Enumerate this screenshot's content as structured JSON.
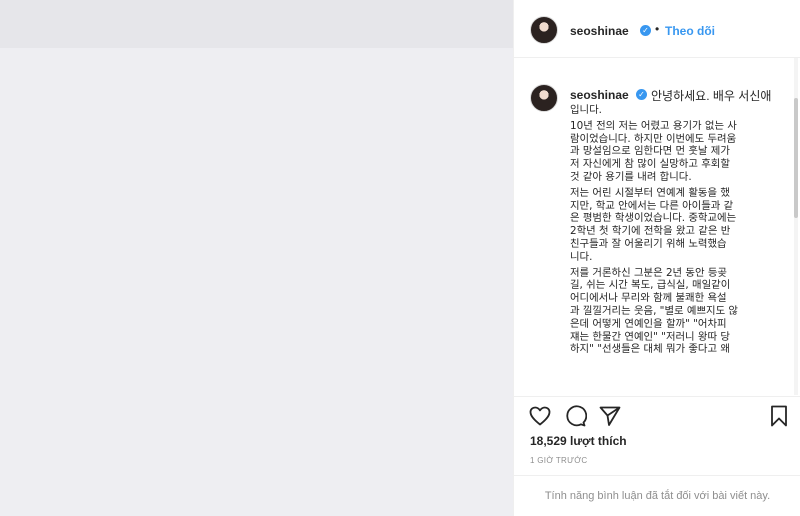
{
  "header": {
    "username": "seoshinae",
    "separator": "•",
    "follow_label": "Theo dõi",
    "verified_icon": "verified-badge-icon",
    "avatar_icon": "profile-avatar"
  },
  "post": {
    "username": "seoshinae",
    "caption_lead": "안녕하세요. 배우 서신애",
    "caption_lines": [
      "입니다.",
      "",
      "10년 전의 저는 어렸고 용기가 없는 사",
      "람이었습니다. 하지만 이번에도 두려움",
      "과 망설임으로 임한다면 먼 훗날 제가",
      "저 자신에게 참 많이 실망하고 후회할",
      "것 같아 용기를 내려 합니다.",
      "",
      "저는 어린 시절부터 연예계 활동을 했",
      "지만, 학교 안에서는 다른 아이들과 같",
      "은 평범한 학생이었습니다. 중학교에는",
      "2학년 첫 학기에 전학을 왔고 같은 반",
      "친구들과 잘 어울리기 위해 노력했습",
      "니다.",
      "",
      "저를 거론하신 그분은 2년 동안 등곶",
      "길, 쉬는 시간 복도, 급식실, 매일같이",
      "어디에서나 무리와 함께 불쾌한 욕설",
      "과 낄낄거리는 웃음, \"별로 예쁘지도 않",
      "은데 어떻게 연예인을 할까\" \"어차피",
      "쟤는 한물간 연예인\" \"저러니 왕따 당",
      "하지\" \"선생들은 대체 뭐가 좋다고 왜"
    ]
  },
  "actions": {
    "like_icon": "heart-icon",
    "comment_icon": "comment-icon",
    "share_icon": "share-icon",
    "save_icon": "bookmark-icon",
    "likes_count": "18,529 lượt thích",
    "timestamp": "1 GIỜ TRƯỚC"
  },
  "comments_disabled_text": "Tính năng bình luận đã tắt đối với bài viết này.",
  "colors": {
    "accent": "#3897f0",
    "text": "#262626",
    "muted": "#8e8e8e",
    "media_bg": "#eeeef2"
  }
}
